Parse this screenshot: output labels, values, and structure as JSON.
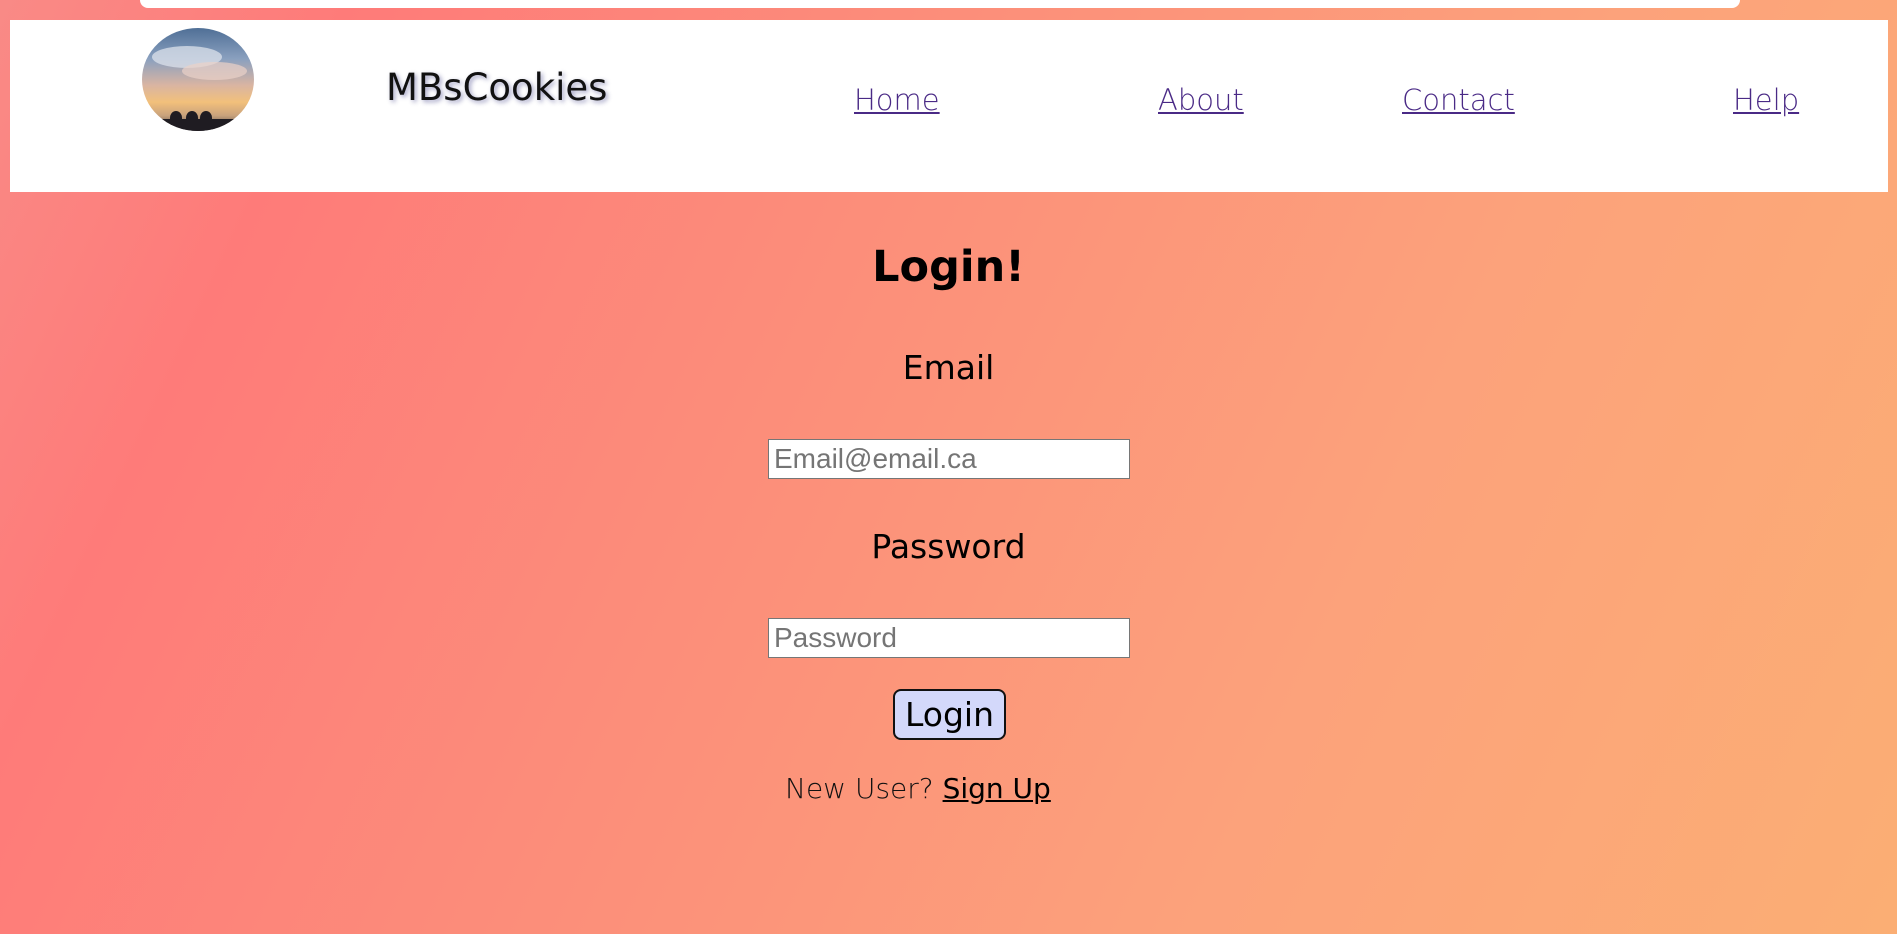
{
  "brand": {
    "name": "MBsCookies",
    "logo_alt": "sky-photo-logo"
  },
  "nav": {
    "home": "Home",
    "about": "About",
    "contact": "Contact",
    "help": "Help"
  },
  "login": {
    "title": "Login!",
    "email_label": "Email",
    "email_placeholder": "Email@email.ca",
    "email_value": "",
    "password_label": "Password",
    "password_placeholder": "Password",
    "password_value": "",
    "button_label": "Login",
    "new_user_text": "New User?",
    "signup_link": "Sign Up"
  },
  "colors": {
    "background_gradient": [
      "#f98a86",
      "#fe7b79",
      "#fca27b",
      "#fbae74"
    ],
    "header_bg": "#ffffff",
    "nav_link": "#4a2a86",
    "login_button_bg": "#d3d8fa"
  }
}
